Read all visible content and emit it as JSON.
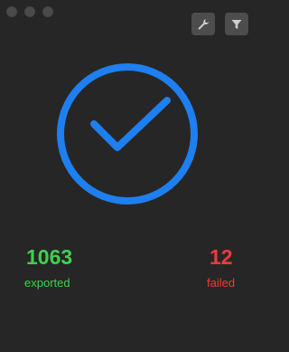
{
  "colors": {
    "background": "#262626",
    "accent": "#1e7ff0",
    "success": "#3fd14f",
    "failure": "#f23a3a",
    "button_bg": "#4d4d4d",
    "icon": "#d0d0d0"
  },
  "window": {
    "controls": [
      "close",
      "minimize",
      "zoom"
    ]
  },
  "toolbar": {
    "settings_icon": "wrench-icon",
    "filter_icon": "filter-icon"
  },
  "status": {
    "icon": "checkmark-circle-icon"
  },
  "stats": {
    "exported": {
      "value": "1063",
      "label": "exported"
    },
    "failed": {
      "value": "12",
      "label": "failed"
    }
  }
}
